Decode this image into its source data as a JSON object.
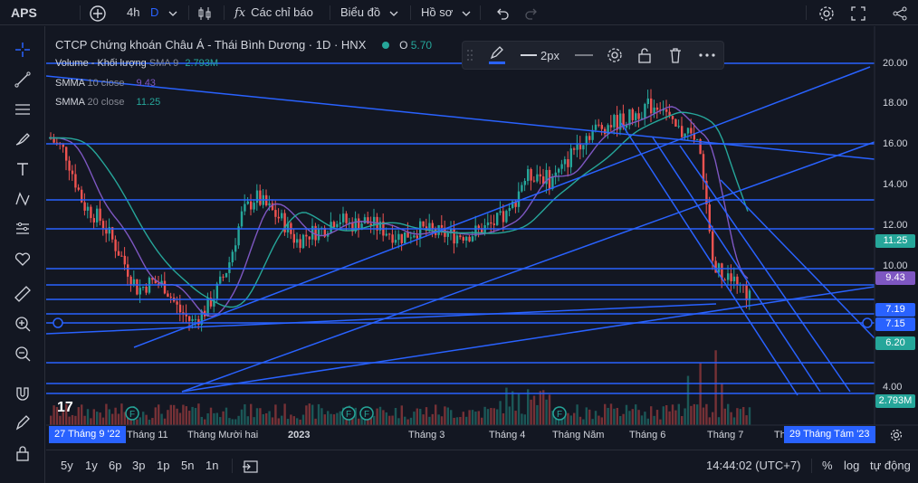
{
  "topbar": {
    "symbol": "APS",
    "interval_1": "4h",
    "interval_2": "D",
    "indicators_label": "Các chỉ báo",
    "chart_label": "Biểu đồ",
    "profile_label": "Hồ sơ"
  },
  "legend": {
    "title": "CTCP Chứng khoán Châu Á - Thái Bình Dương · 1D · HNX",
    "ohlc_prefix": "O",
    "ohlc_value": "5.70",
    "volume_label": "Volume - Khối lượng",
    "volume_sma": "SMA 9",
    "volume_value": "2.793M",
    "smma10_label": "SMMA",
    "smma10_args": "10 close",
    "smma10_value": "9.43",
    "smma20_label": "SMMA",
    "smma20_args": "20 close",
    "smma20_value": "11.25"
  },
  "draw_toolbar": {
    "width_label": "2px"
  },
  "price_axis": {
    "ticks": [
      "20.00",
      "18.00",
      "16.00",
      "14.00",
      "12.00",
      "10.00",
      "4.00"
    ],
    "labels": [
      {
        "value": "11.25",
        "color": "#26a69a"
      },
      {
        "value": "9.43",
        "color": "#7e57c2"
      },
      {
        "value": "7.19",
        "color": "#2962ff"
      },
      {
        "value": "7.15",
        "color": "#2962ff"
      },
      {
        "value": "6.20",
        "color": "#26a69a"
      },
      {
        "value": "2.793M",
        "color": "#26a69a"
      }
    ]
  },
  "time_axis": {
    "start_badge": "27 Tháng 9 '22",
    "end_badge": "29 Tháng Tám '23",
    "labels": [
      "Tháng 11",
      "Tháng Mười hai",
      "2023",
      "Tháng 3",
      "Tháng 4",
      "Tháng Năm",
      "Tháng 6",
      "Tháng 7",
      "Th"
    ]
  },
  "bottombar": {
    "ranges": [
      "5y",
      "1y",
      "6p",
      "3p",
      "1p",
      "5n",
      "1n"
    ],
    "clock": "14:44:02 (UTC+7)",
    "percent": "%",
    "log": "log",
    "auto": "tự động"
  },
  "colors": {
    "up": "#26a69a",
    "down": "#ef5350",
    "drawing": "#2962ff",
    "smma10": "#7e57c2",
    "smma20": "#26a69a"
  }
}
